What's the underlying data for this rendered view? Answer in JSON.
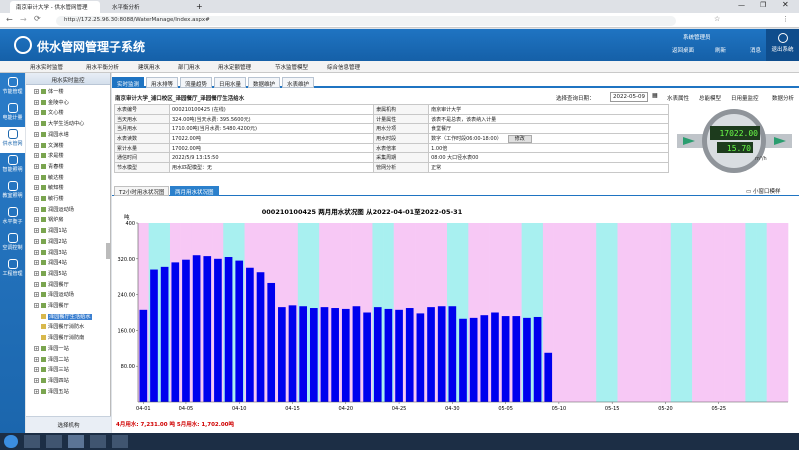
{
  "browser": {
    "tabs": [
      {
        "title": "南京审计大学 - 供水管网管理"
      },
      {
        "title": "水平衡分析"
      }
    ],
    "url": "http://172.25.96.30:8088/WaterManage/Index.aspx#"
  },
  "app": {
    "title": "供水管网管理子系统",
    "header_actions": [
      {
        "label": "系统管理员"
      },
      {
        "label": "返回桌面"
      },
      {
        "label": "刷新"
      },
      {
        "label": "消息"
      },
      {
        "label": "退出系统"
      }
    ]
  },
  "menubar": [
    "用水实时监管",
    "用水平衡分析",
    "建筑用水",
    "部门用水",
    "用水定额管理",
    "节水监管模型",
    "综合信息管理"
  ],
  "leftnav": [
    {
      "label": "节能管理"
    },
    {
      "label": "电能计量"
    },
    {
      "label": "供水管网"
    },
    {
      "label": "智能照明"
    },
    {
      "label": "教室照明"
    },
    {
      "label": "水平衡子"
    },
    {
      "label": "空调控制"
    },
    {
      "label": "工程管理"
    }
  ],
  "tree": {
    "header": "用水实时监控",
    "items": [
      {
        "label": "体一楼",
        "type": "node"
      },
      {
        "label": "金陵中心",
        "type": "node"
      },
      {
        "label": "文心楼",
        "type": "node"
      },
      {
        "label": "大学生活动中心",
        "type": "node"
      },
      {
        "label": "润园水塔",
        "type": "node"
      },
      {
        "label": "文渊楼",
        "type": "node"
      },
      {
        "label": "求是楼",
        "type": "node"
      },
      {
        "label": "青春楼",
        "type": "node"
      },
      {
        "label": "敏达楼",
        "type": "node"
      },
      {
        "label": "敏知楼",
        "type": "node"
      },
      {
        "label": "敏行楼",
        "type": "node"
      },
      {
        "label": "润园运动场",
        "type": "node"
      },
      {
        "label": "锅炉房",
        "type": "node"
      },
      {
        "label": "润园1站",
        "type": "node"
      },
      {
        "label": "润园2站",
        "type": "node"
      },
      {
        "label": "润园3站",
        "type": "node"
      },
      {
        "label": "润园4站",
        "type": "node"
      },
      {
        "label": "润园5站",
        "type": "node"
      },
      {
        "label": "润园餐厅",
        "type": "node"
      },
      {
        "label": "泽园运动场",
        "type": "node"
      },
      {
        "label": "泽园餐厅",
        "type": "node"
      },
      {
        "label": "泽园餐厅生活给水",
        "type": "leaf",
        "selected": true
      },
      {
        "label": "泽园餐厅消防水",
        "type": "leaf"
      },
      {
        "label": "泽园餐厅消防南",
        "type": "leaf"
      },
      {
        "label": "泽园一站",
        "type": "node"
      },
      {
        "label": "泽园二站",
        "type": "node"
      },
      {
        "label": "泽园三站",
        "type": "node"
      },
      {
        "label": "泽园四站",
        "type": "node"
      },
      {
        "label": "泽园五站",
        "type": "node"
      }
    ],
    "footer": "选择机构"
  },
  "content": {
    "tabs": [
      "实时监测",
      "用水排等",
      "流量趋势",
      "日用水量",
      "数据维护",
      "水表维护"
    ],
    "active_tab": 0,
    "breadcrumb": "南京审计大学_浦口校区_泽园餐厅_泽园餐厅生活给水",
    "date_label": "选择查询日期：",
    "date_value": "2022-05-09",
    "toolbar": [
      "水表属性",
      "总能模型",
      "日用量监控",
      "数据分析"
    ],
    "rows": [
      {
        "k1": "水表编号",
        "v1": "000210100425 (在线)",
        "k2": "隶属机构",
        "v2": "南京审计大学"
      },
      {
        "k1": "当天用水",
        "v1": "324.00吨(当天水费: 395.5600元)",
        "k2": "计量属性",
        "v2": "该表不是总表，该表纳入计量"
      },
      {
        "k1": "当月用水",
        "v1": "1710.00吨(当月水费: 5480.4200元)",
        "k2": "用水分项",
        "v2": "食堂餐厅"
      },
      {
        "k1": "水表读数",
        "v1": "17022.00吨",
        "k2": "用水时段",
        "v2": "数字（工作时段06:00-18:00）",
        "btn": "修改"
      },
      {
        "k1": "累计水量",
        "v1": "17002.00吨",
        "k2": "水表倍率",
        "v2": "1.00倍"
      },
      {
        "k1": "通信时间",
        "v1": "2022/5/9 13:15:50",
        "k2": "采集周期",
        "v2": "08:00  大口径水表00"
      },
      {
        "k1": "节水模型",
        "v1": "用水匹配模型：无",
        "k2": "管网分析",
        "v2": "正常"
      }
    ],
    "meter": {
      "reading": "17022.00",
      "flow": "15.70",
      "unit": "m³/h"
    },
    "subtabs": [
      "T2小时用水状况图",
      "两月用水状况图"
    ],
    "active_subtab": 1,
    "chart_hint": "小窗口模样",
    "footer_text": "4月用水: 7,231.00 吨  5月用水: 1,702.00吨"
  },
  "chart_data": {
    "type": "bar",
    "title": "000210100425 两月用水状况图  从2022-04-01至2022-05-31",
    "ylabel": "吨",
    "ylim": [
      0,
      400
    ],
    "yticks": [
      80,
      160,
      240,
      320,
      400
    ],
    "ytick_labels": [
      "80.00",
      "160.00",
      "240.00",
      "320.00",
      "400"
    ],
    "x_tick_labels": [
      "04-01",
      "04-05",
      "04-10",
      "04-15",
      "04-20",
      "04-25",
      "04-30",
      "05-05",
      "05-10",
      "05-15",
      "05-20",
      "05-25"
    ],
    "x_tick_days": [
      1,
      5,
      10,
      15,
      20,
      25,
      30,
      35,
      40,
      45,
      50,
      55
    ],
    "bar_color": "#0000ee",
    "weekend_color": "#a8f0f0",
    "weekday_color": "#f7c8f5",
    "weekend_days": [
      2,
      3,
      9,
      10,
      16,
      17,
      23,
      24,
      30,
      31,
      37,
      38,
      44,
      45,
      51,
      52,
      58,
      59
    ],
    "values": [
      206,
      296,
      302,
      312,
      318,
      328,
      326,
      320,
      324,
      316,
      300,
      290,
      266,
      212,
      216,
      214,
      210,
      212,
      210,
      208,
      214,
      200,
      212,
      208,
      206,
      210,
      198,
      212,
      214,
      214,
      186,
      188,
      194,
      200,
      192,
      192,
      188,
      190,
      110
    ]
  }
}
